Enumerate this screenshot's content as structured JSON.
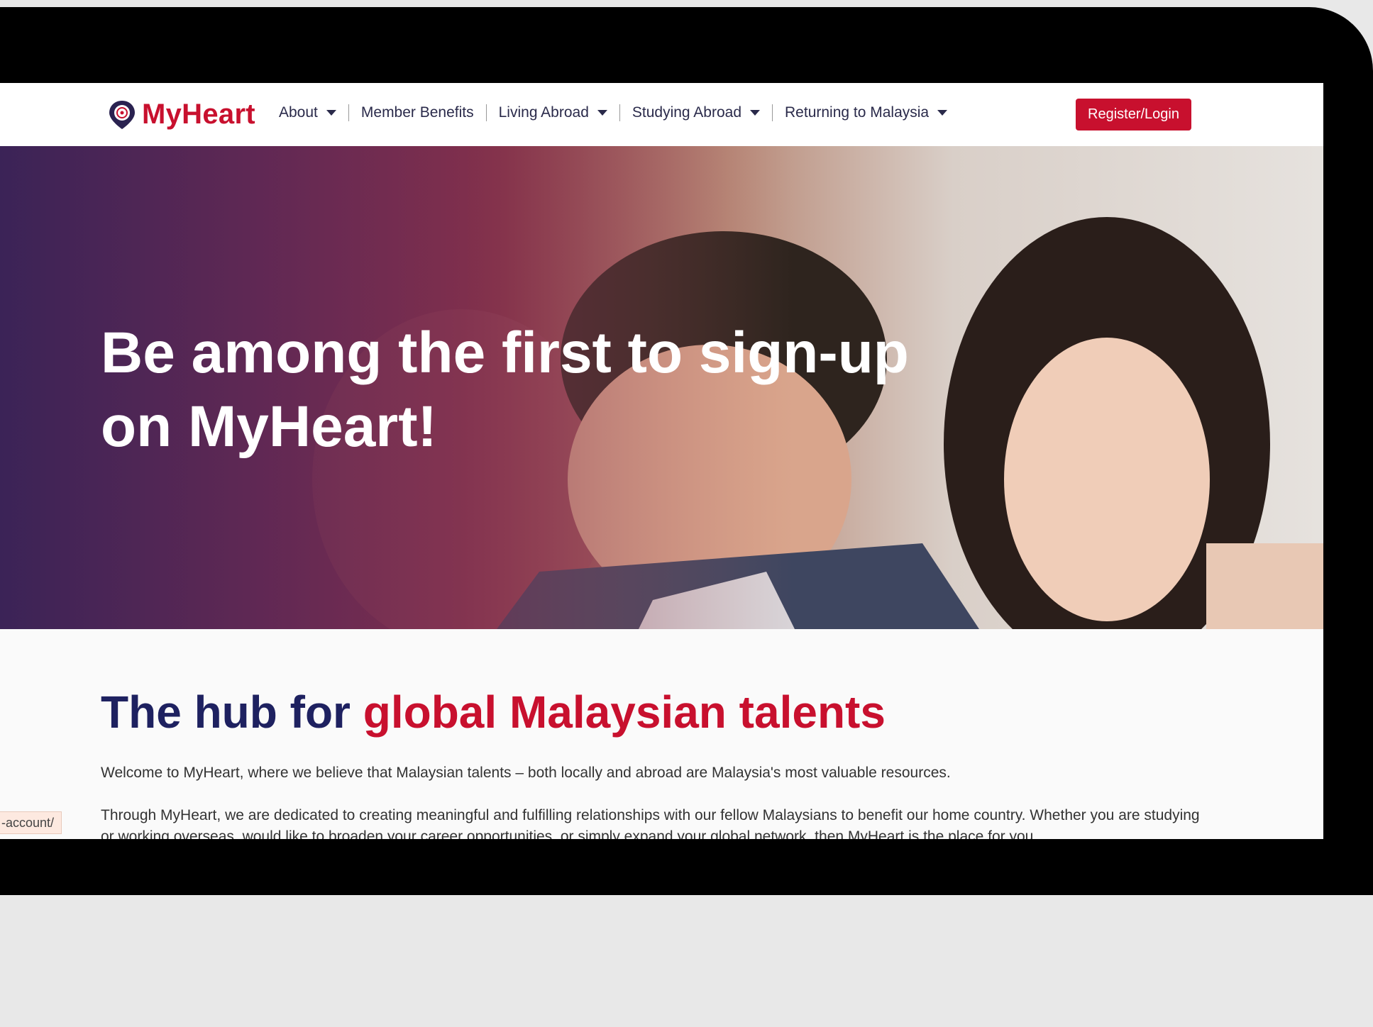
{
  "logo": {
    "text": "MyHeart"
  },
  "nav": {
    "items": [
      {
        "label": "About",
        "dropdown": true
      },
      {
        "label": "Member Benefits",
        "dropdown": false
      },
      {
        "label": "Living Abroad",
        "dropdown": true
      },
      {
        "label": "Studying Abroad",
        "dropdown": true
      },
      {
        "label": "Returning to Malaysia",
        "dropdown": true
      }
    ],
    "register_label": "Register/Login"
  },
  "hero": {
    "title": "Be among the first to sign-up on MyHeart!"
  },
  "content": {
    "heading_part1": "The hub for ",
    "heading_part2": "global Malaysian talents",
    "para1": "Welcome to MyHeart, where we believe that Malaysian talents – both locally and abroad are Malaysia's most valuable resources.",
    "para2": "Through MyHeart, we are dedicated to creating meaningful and fulfilling relationships with our fellow Malaysians to benefit our home country. Whether you are studying or working overseas, would like to broaden your career opportunities, or simply expand your global network, then MyHeart is the place for you."
  },
  "status_url": "-account/",
  "colors": {
    "brand_red": "#c8102e",
    "navy": "#1e2160"
  }
}
